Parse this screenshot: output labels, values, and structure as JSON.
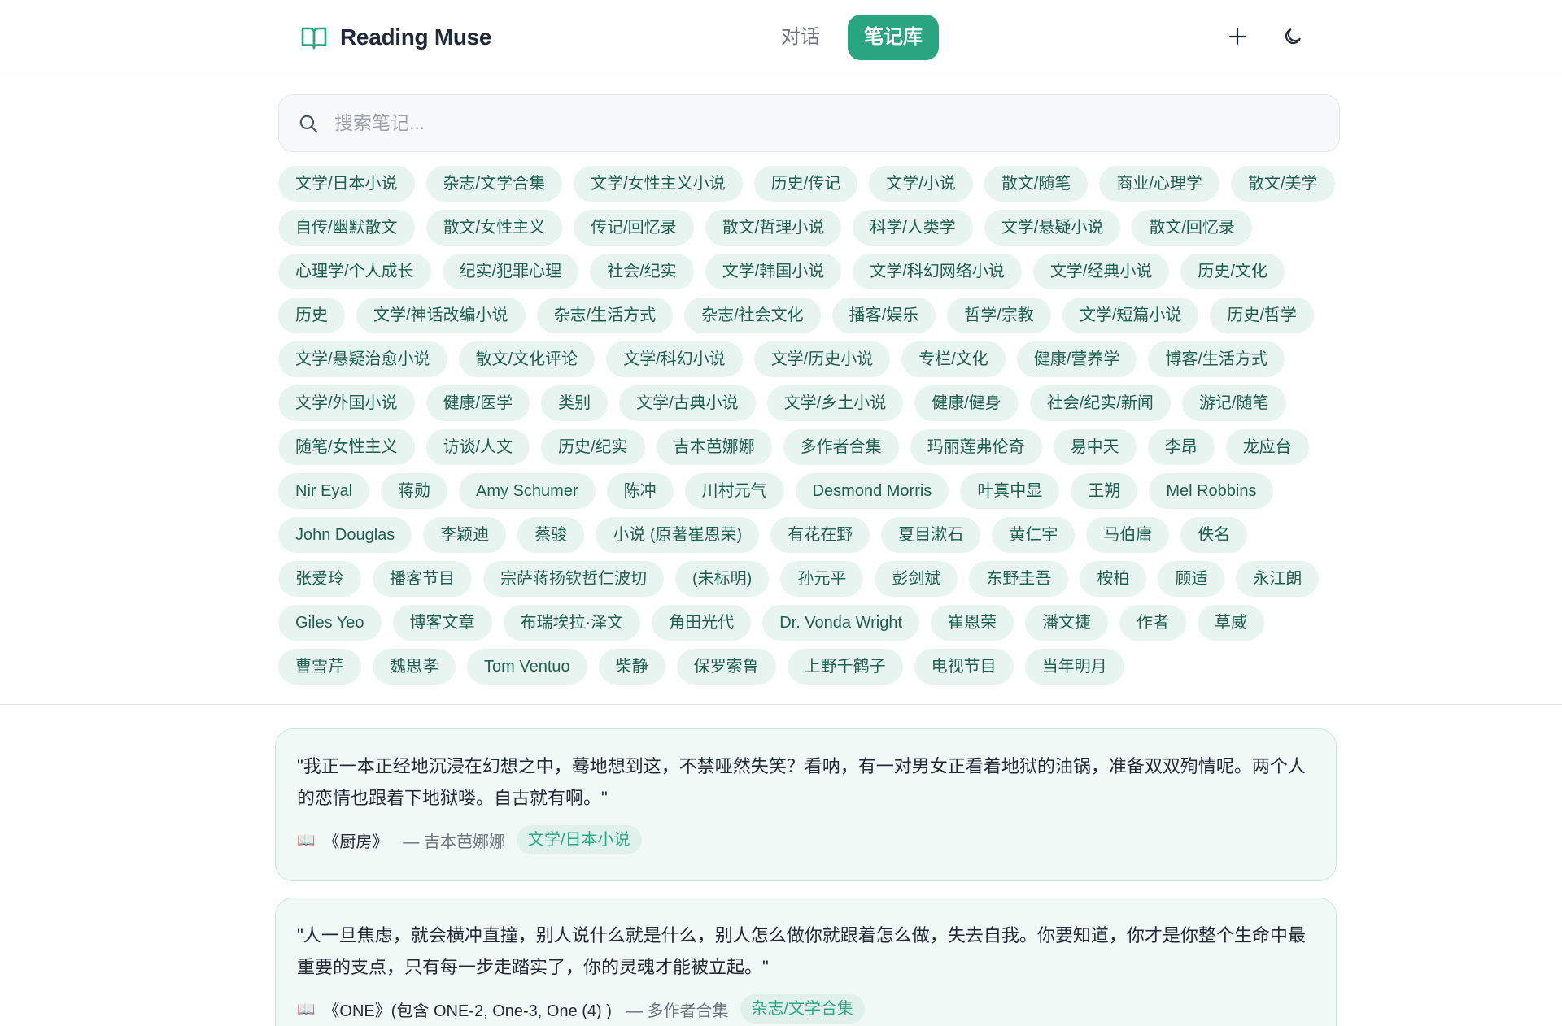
{
  "app": {
    "title": "Reading Muse",
    "icon": "open-book-icon",
    "accent_color": "#2aa582"
  },
  "nav": {
    "tabs": [
      {
        "label": "对话",
        "active": false
      },
      {
        "label": "笔记库",
        "active": true
      }
    ],
    "new_icon": "plus-icon",
    "theme_icon": "moon-icon"
  },
  "search": {
    "placeholder": "搜索笔记...",
    "value": ""
  },
  "tags": [
    "文学/日本小说",
    "杂志/文学合集",
    "文学/女性主义小说",
    "历史/传记",
    "文学/小说",
    "散文/随笔",
    "商业/心理学",
    "散文/美学",
    "自传/幽默散文",
    "散文/女性主义",
    "传记/回忆录",
    "散文/哲理小说",
    "科学/人类学",
    "文学/悬疑小说",
    "散文/回忆录",
    "心理学/个人成长",
    "纪实/犯罪心理",
    "社会/纪实",
    "文学/韩国小说",
    "文学/科幻网络小说",
    "文学/经典小说",
    "历史/文化",
    "历史",
    "文学/神话改编小说",
    "杂志/生活方式",
    "杂志/社会文化",
    "播客/娱乐",
    "哲学/宗教",
    "文学/短篇小说",
    "历史/哲学",
    "文学/悬疑治愈小说",
    "散文/文化评论",
    "文学/科幻小说",
    "文学/历史小说",
    "专栏/文化",
    "健康/营养学",
    "博客/生活方式",
    "文学/外国小说",
    "健康/医学",
    "类别",
    "文学/古典小说",
    "文学/乡土小说",
    "健康/健身",
    "社会/纪实/新闻",
    "游记/随笔",
    "随笔/女性主义",
    "访谈/人文",
    "历史/纪实",
    "吉本芭娜娜",
    "多作者合集",
    "玛丽莲弗伦奇",
    "易中天",
    "李昂",
    "龙应台",
    "Nir Eyal",
    "蒋勋",
    "Amy Schumer",
    "陈冲",
    "川村元气",
    "Desmond Morris",
    "叶真中显",
    "王朔",
    "Mel Robbins",
    "John Douglas",
    "李颖迪",
    "蔡骏",
    "小说 (原著崔恩荣)",
    "有花在野",
    "夏目漱石",
    "黄仁宇",
    "马伯庸",
    "佚名",
    "张爱玲",
    "播客节目",
    "宗萨蒋扬钦哲仁波切",
    "(未标明)",
    "孙元平",
    "彭剑斌",
    "东野圭吾",
    "桉柏",
    "顾适",
    "永江朗",
    "Giles Yeo",
    "博客文章",
    "布瑞埃拉·泽文",
    "角田光代",
    "Dr. Vonda Wright",
    "崔恩荣",
    "潘文捷",
    "作者",
    "草威",
    "曹雪芹",
    "魏思孝",
    "Tom Ventuo",
    "柴静",
    "保罗索鲁",
    "上野千鹤子",
    "电视节目",
    "当年明月"
  ],
  "notes": [
    {
      "quote": "\"我正一本正经地沉浸在幻想之中，蓦地想到这，不禁哑然失笑？看呐，有一对男女正看着地狱的油锅，准备双双殉情呢。两个人的恋情也跟着下地狱喽。自古就有啊。\"",
      "book_icon": "📖",
      "title": "《厨房》",
      "author": "— 吉本芭娜娜",
      "category": "文学/日本小说"
    },
    {
      "quote": "\"人一旦焦虑，就会横冲直撞，别人说什么就是什么，别人怎么做你就跟着怎么做，失去自我。你要知道，你才是你整个生命中最重要的支点，只有每一步走踏实了，你的灵魂才能被立起。\"",
      "book_icon": "📖",
      "title": "《ONE》(包含 ONE-2, One-3, One (4) )",
      "author": "— 多作者合集",
      "category": "杂志/文学合集"
    }
  ]
}
